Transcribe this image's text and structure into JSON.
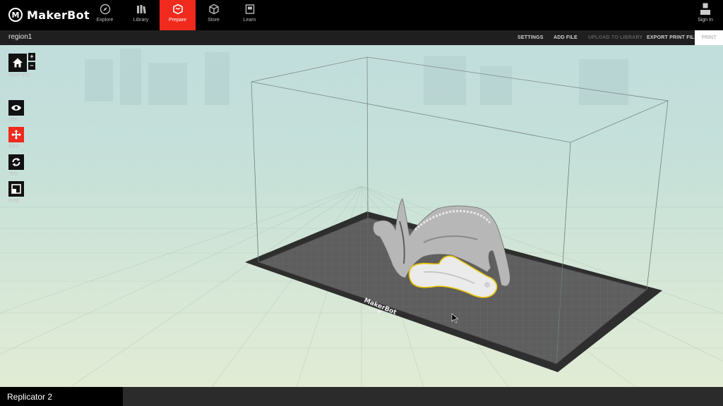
{
  "app": {
    "logo_text": "MakerBot"
  },
  "nav": {
    "tabs": [
      {
        "label": "Explore",
        "icon": "compass-icon"
      },
      {
        "label": "Library",
        "icon": "library-icon"
      },
      {
        "label": "Prepare",
        "icon": "prepare-cube-icon",
        "active": true
      },
      {
        "label": "Store",
        "icon": "store-cube-icon"
      },
      {
        "label": "Learn",
        "icon": "learn-book-icon"
      }
    ],
    "sign_in": "Sign In"
  },
  "subbar": {
    "filename": "region1",
    "settings": "SETTINGS",
    "add_file": "ADD FILE",
    "upload": "UPLOAD TO LIBRARY",
    "export": "EXPORT PRINT FILE",
    "print": "PRINT"
  },
  "tools": {
    "home_view": "Home View",
    "zoom_in": "+",
    "zoom_out": "−",
    "view": "View",
    "move": "Move",
    "turn": "Turn",
    "scale": "Scale"
  },
  "plate": {
    "brand": "MakerBot"
  },
  "status": {
    "printer": "Replicator 2"
  },
  "colors": {
    "accent": "#f02a1d",
    "selection": "#e8c400"
  }
}
